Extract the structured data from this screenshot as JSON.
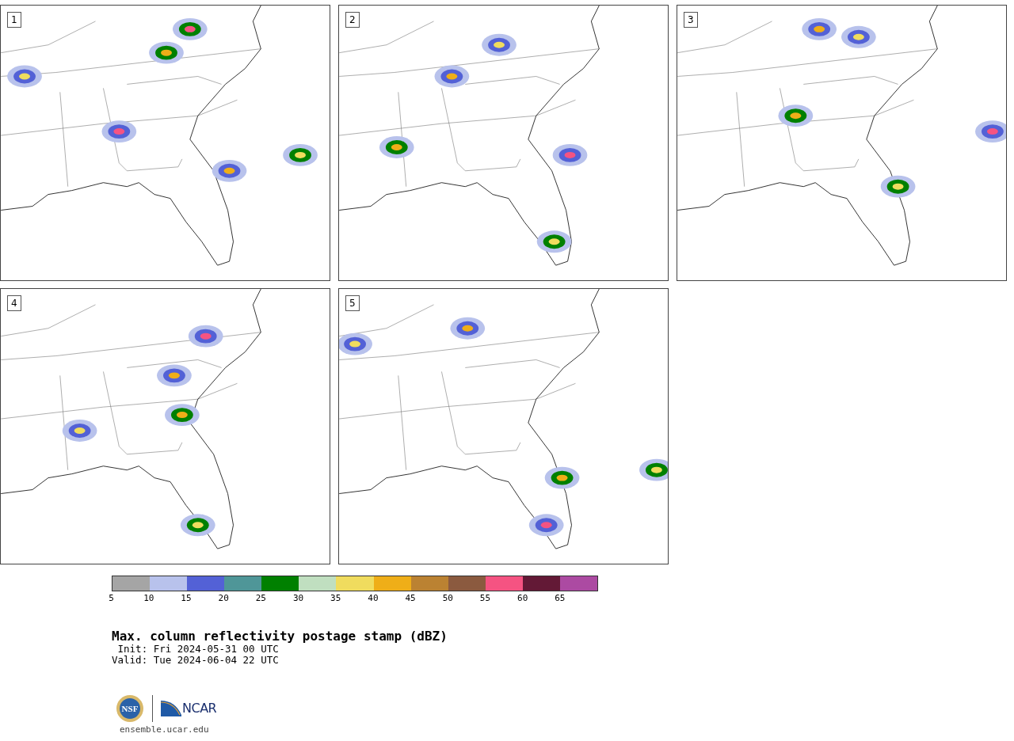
{
  "panels": [
    {
      "number": "1"
    },
    {
      "number": "2"
    },
    {
      "number": "3"
    },
    {
      "number": "4"
    },
    {
      "number": "5"
    }
  ],
  "colorbar": {
    "bins": [
      {
        "color": "#a5a5a5"
      },
      {
        "color": "#b8c2ec"
      },
      {
        "color": "#5361d6"
      },
      {
        "color": "#4f9698"
      },
      {
        "color": "#008000"
      },
      {
        "color": "#c0dfc0"
      },
      {
        "color": "#f0dc5e"
      },
      {
        "color": "#efae18"
      },
      {
        "color": "#bb8232"
      },
      {
        "color": "#8b5a3f"
      },
      {
        "color": "#f55382"
      },
      {
        "color": "#631936"
      },
      {
        "color": "#ac4aa2"
      }
    ],
    "ticks": [
      "5",
      "10",
      "15",
      "20",
      "25",
      "30",
      "35",
      "40",
      "45",
      "50",
      "55",
      "60",
      "65"
    ]
  },
  "title": "Max. column reflectivity postage stamp (dBZ)",
  "init": " Init: Fri 2024-05-31 00 UTC",
  "valid": "Valid: Tue 2024-06-04 22 UTC",
  "logos": {
    "nsf": "NSF",
    "ncar": "NCAR"
  },
  "url": "ensemble.ucar.edu"
}
